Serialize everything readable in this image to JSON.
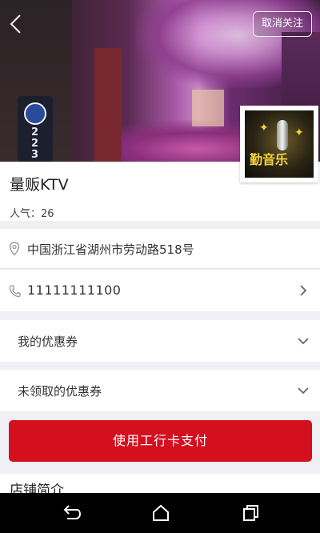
{
  "header": {
    "back_icon": "chevron-left-icon",
    "unfollow_label": "取消关注"
  },
  "shop": {
    "name": "量贩KTV",
    "popularity": "人气：26",
    "sign_numbers": [
      "2",
      "2",
      "3"
    ],
    "logo_text": "勤音乐"
  },
  "contact": {
    "address": "中国浙江省湖州市劳动路518号",
    "phone": "11111111100"
  },
  "coupons": {
    "mine_label": "我的优惠券",
    "unclaimed_label": "未领取的优惠券"
  },
  "pay_button_label": "使用工行卡支付",
  "intro_title": "店铺简介",
  "colors": {
    "accent": "#d40f1e",
    "background": "#efeff4"
  }
}
